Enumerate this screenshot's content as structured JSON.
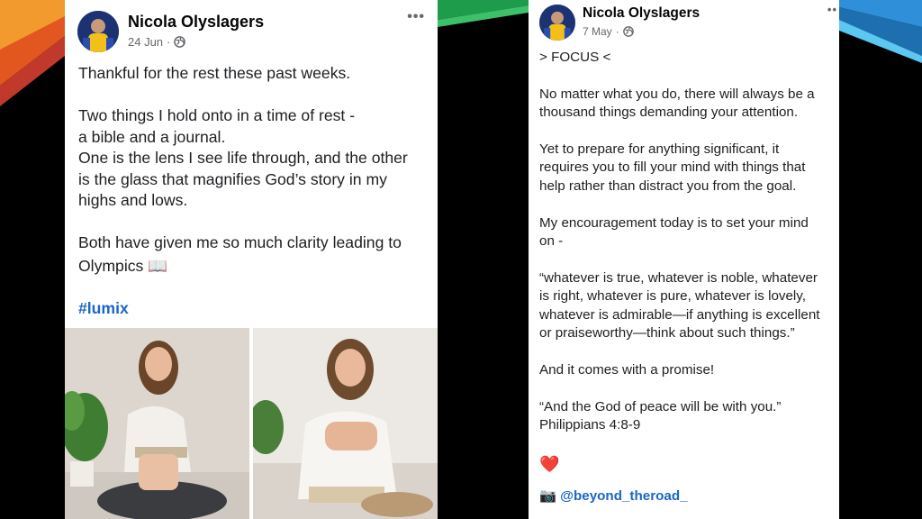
{
  "colors": {
    "link": "#1a66c6",
    "meta": "#65676b",
    "background": "#000000"
  },
  "post_left": {
    "author": "Nicola Olyslagers",
    "date": "24 Jun",
    "separator": "·",
    "audience_icon": "globe-icon",
    "menu_label": "•••",
    "lines": [
      "Thankful for the rest these past weeks.",
      "",
      "Two things I hold onto in a time of rest -",
      "a bible and a journal.",
      "One is the lens I see life through, and the other",
      "is the glass that magnifies God’s story in my",
      "highs and lows.",
      "",
      "Both have given me so much clarity leading to",
      "Olympics 📖"
    ],
    "hashtag": "#lumix",
    "images": [
      "photo-woman-sitting-with-books",
      "photo-woman-smiling-with-bible"
    ]
  },
  "post_right": {
    "author": "Nicola Olyslagers",
    "date": "7 May",
    "separator": "·",
    "audience_icon": "globe-icon",
    "menu_label": "••",
    "lines": [
      "> FOCUS <",
      "",
      "No matter what you do, there will always be a",
      "thousand things demanding your attention.",
      "",
      "Yet to prepare for anything significant, it",
      "requires you to fill your mind with things that",
      "help rather than distract you from the goal.",
      "",
      "My encouragement today is to set your mind",
      "on -",
      "",
      "“whatever is true, whatever is noble, whatever",
      "is right, whatever is pure, whatever is lovely,",
      "whatever is admirable—if anything is excellent",
      "or praiseworthy—think about such things.”",
      "",
      "And it comes with a promise!",
      "",
      "“And the God of peace will be with you.”",
      "Philippians 4:8-9",
      "",
      "",
      "❤️"
    ],
    "camera_icon": "📷",
    "handle": "@beyond_theroad_"
  }
}
